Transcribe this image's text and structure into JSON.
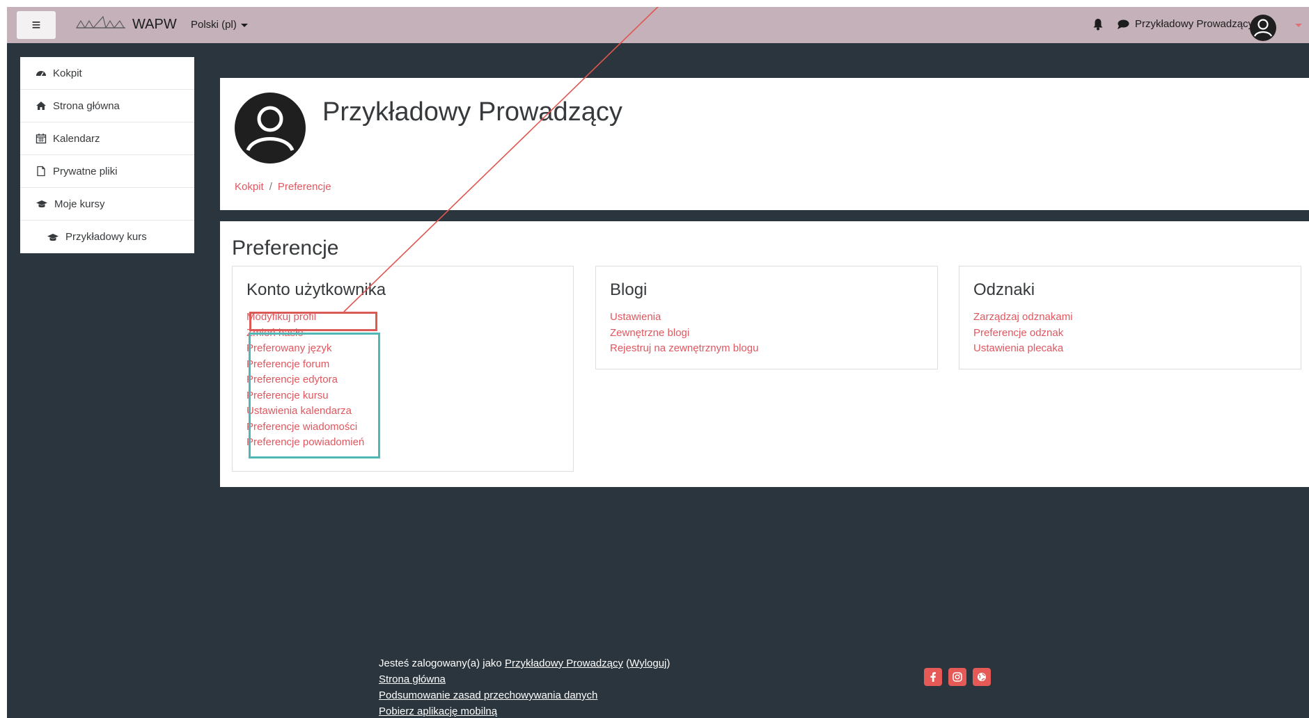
{
  "topbar": {
    "menu_icon": "hamburger-icon",
    "brand": "WAPW",
    "language": "Polski ‎(pl)‎",
    "user_name": "Przykładowy Prowadzący",
    "bg_color": "#c5b1b9"
  },
  "drawer": {
    "items": [
      {
        "label": "Kokpit",
        "icon": "dashboard-icon"
      },
      {
        "label": "Strona główna",
        "icon": "home-icon"
      },
      {
        "label": "Kalendarz",
        "icon": "calendar-icon"
      },
      {
        "label": "Prywatne pliki",
        "icon": "file-icon"
      },
      {
        "label": "Moje kursy",
        "icon": "graduation-cap-icon"
      },
      {
        "label": "Przykładowy kurs",
        "icon": "graduation-cap-icon"
      }
    ]
  },
  "header": {
    "title": "Przykładowy Prowadzący",
    "breadcrumb": [
      "Kokpit",
      "Preferencje"
    ]
  },
  "main": {
    "title": "Preferencje",
    "sections": [
      {
        "title": "Konto użytkownika",
        "links": [
          "Modyfikuj profil",
          "Zmień hasło",
          "Preferowany język",
          "Preferencje forum",
          "Preferencje edytora",
          "Preferencje kursu",
          "Ustawienia kalendarza",
          "Preferencje wiadomości",
          "Preferencje powiadomień"
        ]
      },
      {
        "title": "Blogi",
        "links": [
          "Ustawienia",
          "Zewnętrzne blogi",
          "Rejestruj na zewnętrznym blogu"
        ]
      },
      {
        "title": "Odznaki",
        "links": [
          "Zarządzaj odznakami",
          "Preferencje odznak",
          "Ustawienia plecaka"
        ]
      }
    ]
  },
  "footer": {
    "logged_prefix": "Jesteś zalogowany(a) jako",
    "user_link": "Przykładowy Prowadzący",
    "logout": "Wyloguj",
    "home": "Strona główna",
    "data_summary": "Podsumowanie zasad przechowywania danych",
    "mobile_app": "Pobierz aplikację mobilną"
  },
  "social": [
    "facebook-icon",
    "instagram-icon",
    "globe-icon"
  ],
  "colors": {
    "accent": "#e0575f",
    "highlight_red": "#dc5a56",
    "highlight_teal": "#4fb7b5",
    "page_bg": "#2b353d"
  }
}
